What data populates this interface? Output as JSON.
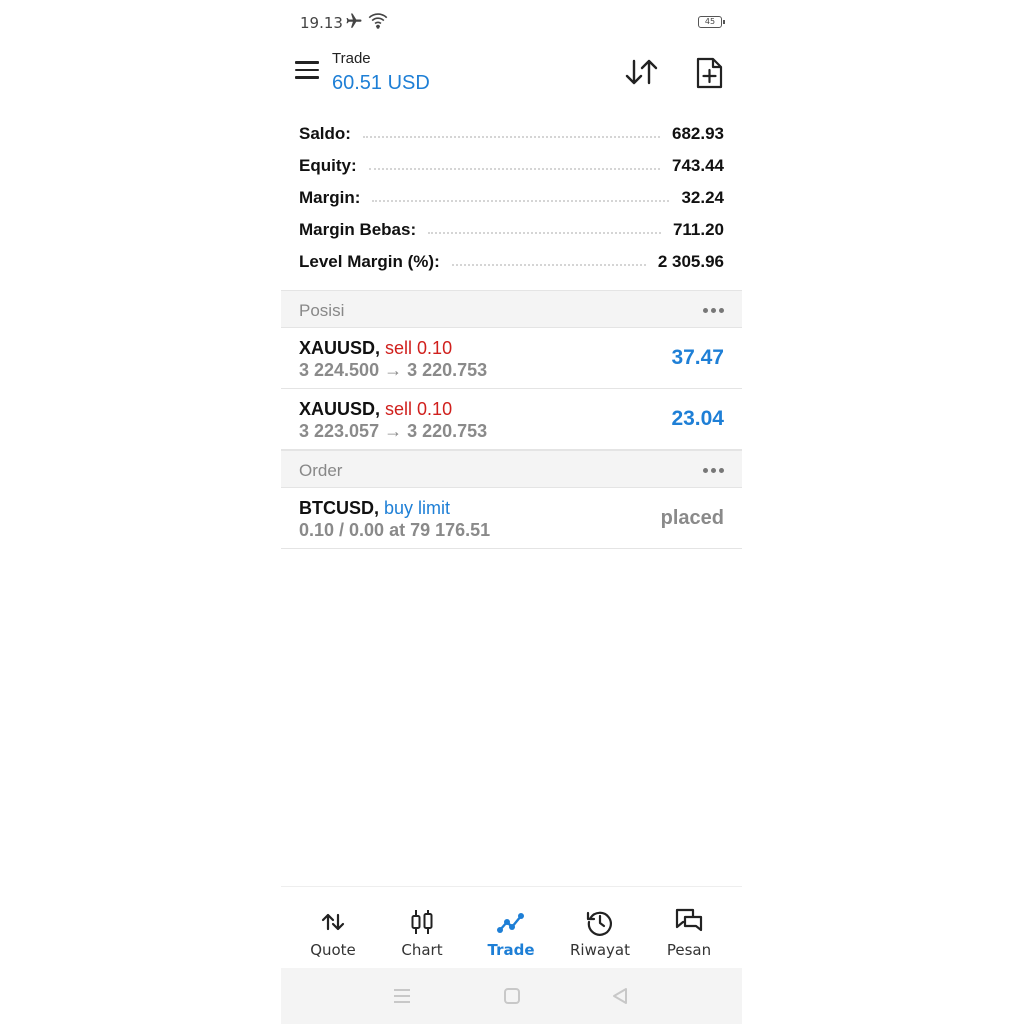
{
  "status": {
    "time": "19.13",
    "battery": "45"
  },
  "header": {
    "title": "Trade",
    "balance": "60.51 USD"
  },
  "summary": [
    {
      "label": "Saldo:",
      "value": "682.93"
    },
    {
      "label": "Equity:",
      "value": "743.44"
    },
    {
      "label": "Margin:",
      "value": "32.24"
    },
    {
      "label": "Margin Bebas:",
      "value": "711.20"
    },
    {
      "label": "Level Margin (%):",
      "value": "2 305.96"
    }
  ],
  "positions": {
    "title": "Posisi",
    "items": [
      {
        "symbol": "XAUUSD,",
        "side": "sell 0.10",
        "prices": "3 224.500 → 3 220.753",
        "profit": "37.47"
      },
      {
        "symbol": "XAUUSD,",
        "side": "sell 0.10",
        "prices": "3 223.057 → 3 220.753",
        "profit": "23.04"
      }
    ]
  },
  "orders": {
    "title": "Order",
    "items": [
      {
        "symbol": "BTCUSD,",
        "side": "buy limit",
        "details": "0.10 / 0.00 at 79 176.51",
        "status": "placed"
      }
    ]
  },
  "nav": [
    {
      "label": "Quote",
      "icon": "quote-icon"
    },
    {
      "label": "Chart",
      "icon": "chart-icon"
    },
    {
      "label": "Trade",
      "icon": "trade-icon",
      "active": true
    },
    {
      "label": "Riwayat",
      "icon": "history-icon"
    },
    {
      "label": "Pesan",
      "icon": "messages-icon"
    }
  ],
  "colors": {
    "accent": "#1e7fd6",
    "sell": "#d0201d",
    "muted": "#8a8a8a"
  }
}
